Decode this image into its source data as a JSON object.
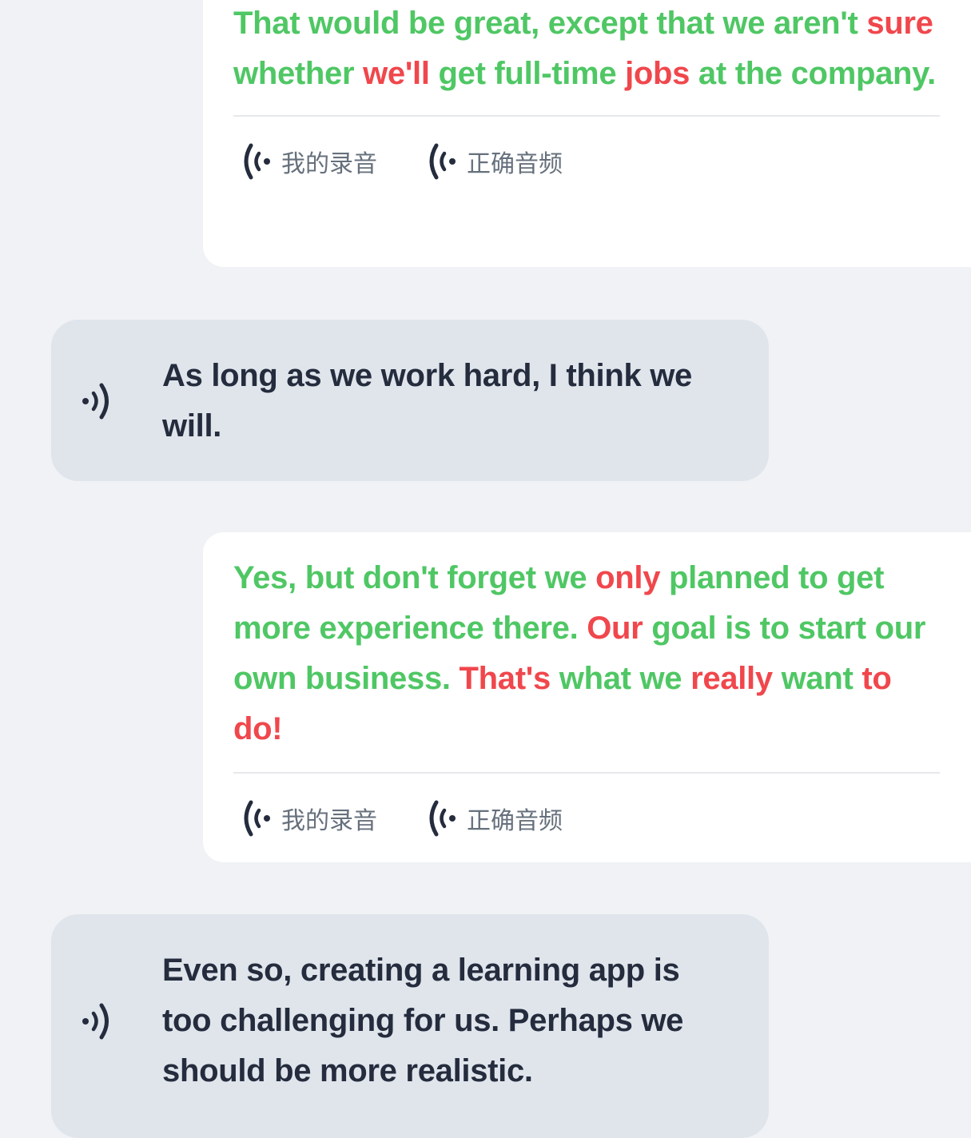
{
  "messages": [
    {
      "role": "user",
      "tokens": [
        {
          "t": "That would be great, except that we aren't ",
          "s": "good"
        },
        {
          "t": "sure",
          "s": "bad"
        },
        {
          "t": " whether ",
          "s": "good"
        },
        {
          "t": "we'll",
          "s": "bad"
        },
        {
          "t": " get full-time ",
          "s": "good"
        },
        {
          "t": "jobs",
          "s": "bad"
        },
        {
          "t": " at the company.",
          "s": "good"
        }
      ],
      "my_recording_label": "我的录音",
      "correct_audio_label": "正确音频"
    },
    {
      "role": "bot",
      "text": "As long as we work hard, I think we will."
    },
    {
      "role": "user",
      "tokens": [
        {
          "t": "Yes, but don't forget we ",
          "s": "good"
        },
        {
          "t": "only",
          "s": "bad"
        },
        {
          "t": " planned to get more experience there. ",
          "s": "good"
        },
        {
          "t": "Our",
          "s": "bad"
        },
        {
          "t": " goal is to start our own business. ",
          "s": "good"
        },
        {
          "t": "That's",
          "s": "bad"
        },
        {
          "t": " what we ",
          "s": "good"
        },
        {
          "t": "really",
          "s": "bad"
        },
        {
          "t": " want ",
          "s": "good"
        },
        {
          "t": "to do!",
          "s": "bad"
        }
      ],
      "my_recording_label": "我的录音",
      "correct_audio_label": "正确音频"
    },
    {
      "role": "bot",
      "text": "Even so, creating a learning app is too challenging for us. Perhaps we should be more realistic."
    }
  ],
  "colors": {
    "correct": "#4fc764",
    "incorrect": "#f0474c",
    "bot_text": "#242c3d",
    "background": "#f0f2f5"
  },
  "icons": {
    "record": "sound-wave-left-icon",
    "speaker": "speaker-icon"
  }
}
